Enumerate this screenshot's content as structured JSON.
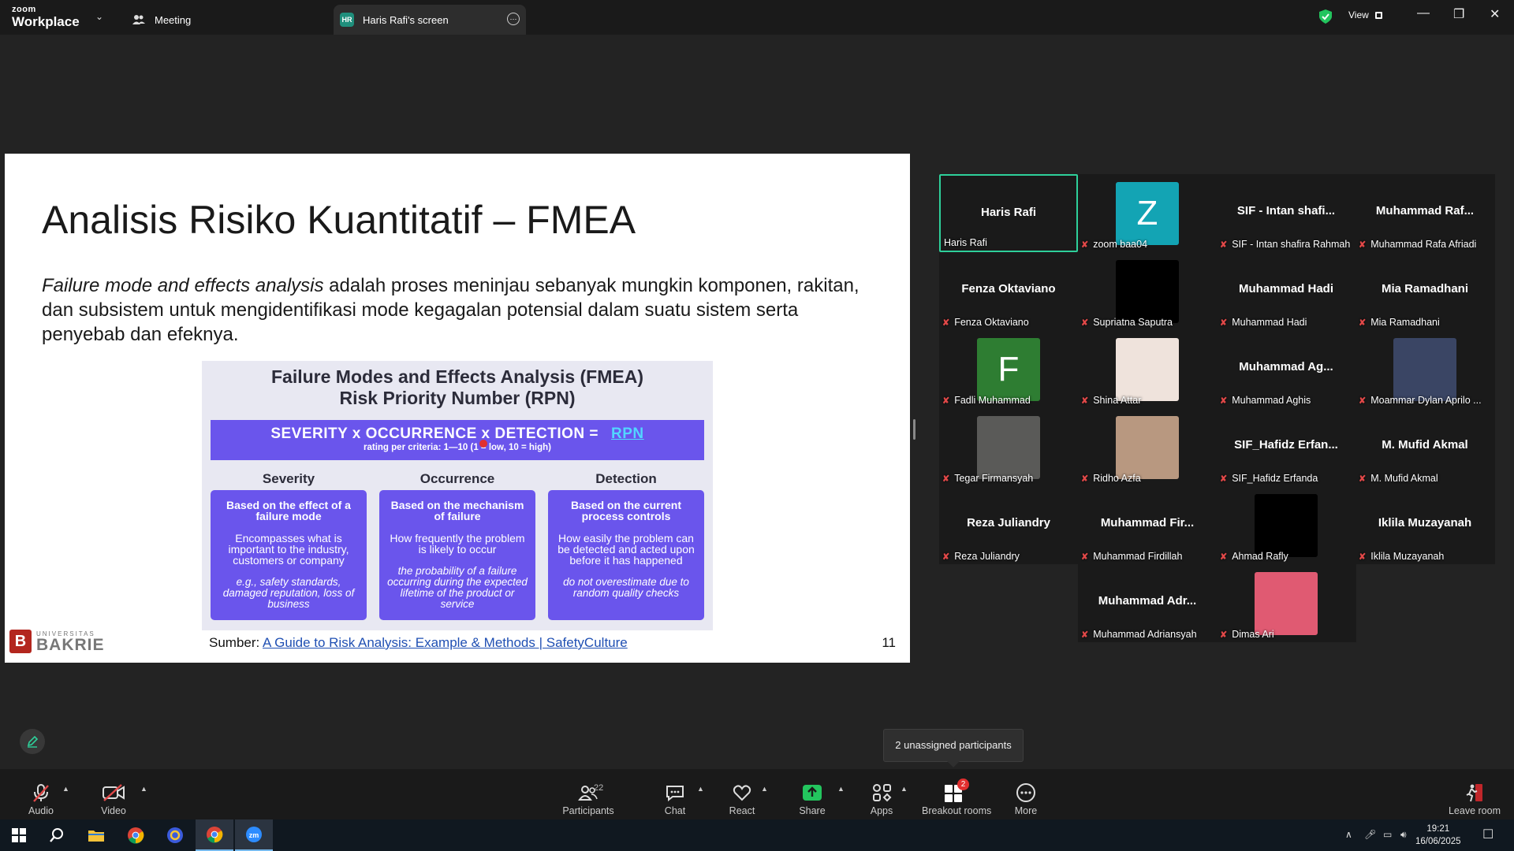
{
  "app": {
    "logo_small": "zoom",
    "logo_big": "Workplace",
    "tab_meeting": "Meeting",
    "tab_screen_initials": "HR",
    "tab_screen": "Haris Rafi's screen",
    "view_label": "View"
  },
  "slide": {
    "title": "Analisis Risiko Kuantitatif – FMEA",
    "para_italic": "Failure mode and effects analysis",
    "para_rest": " adalah proses meninjau sebanyak mungkin komponen, rakitan, dan subsistem untuk mengidentifikasi mode kegagalan potensial dalam suatu sistem serta penyebab dan efeknya.",
    "info_title_1": "Failure Modes and Effects Analysis (FMEA)",
    "info_title_2": "Risk Priority Number (RPN)",
    "formula": "SEVERITY x OCCURRENCE x DETECTION =",
    "formula_result": "RPN",
    "formula_sub": "rating per criteria: 1—10 (1 = low, 10 = high)",
    "columns": [
      {
        "head": "Severity",
        "card_h": "Based on the effect of a failure mode",
        "card_d": "Encompasses what is important to the industry, customers or company",
        "card_e": "e.g., safety standards, damaged reputation, loss of business"
      },
      {
        "head": "Occurrence",
        "card_h": "Based on the mechanism of failure",
        "card_d": "How frequently the problem is likely to occur",
        "card_e": "the probability of a failure occurring during the expected lifetime of the product or service"
      },
      {
        "head": "Detection",
        "card_h": "Based on the current process controls",
        "card_d": "How easily the problem can be detected and acted upon before it has happened",
        "card_e": "do not overestimate due to random quality checks"
      }
    ],
    "logo_top": "UNIVERSITAS",
    "logo_bottom": "BAKRIE",
    "source_label": "Sumber: ",
    "source_link": "A Guide to Risk Analysis: Example & Methods | SafetyCulture",
    "page_number": "11"
  },
  "participants": [
    {
      "name": "Haris Rafi",
      "label": "Haris Rafi",
      "muted": false,
      "active": true
    },
    {
      "avatar": "Z",
      "avatar_color": "#13a4b4",
      "label": "zoom baa04",
      "muted": true
    },
    {
      "name": "SIF - Intan shafi...",
      "label": "SIF - Intan shafira Rahmah",
      "muted": true
    },
    {
      "name": "Muhammad Raf...",
      "label": "Muhammad Rafa Afriadi",
      "muted": true
    },
    {
      "name": "Fenza Oktaviano",
      "label": "Fenza Oktaviano",
      "muted": true
    },
    {
      "avatar": "",
      "avatar_color": "#000000",
      "label": "Supriatna Saputra",
      "muted": true
    },
    {
      "name": "Muhammad Hadi",
      "label": "Muhammad Hadi",
      "muted": true
    },
    {
      "name": "Mia Ramadhani",
      "label": "Mia Ramadhani",
      "muted": true
    },
    {
      "avatar": "F",
      "avatar_color": "#2e7d32",
      "label": "Fadli Muhammad",
      "muted": true
    },
    {
      "avatar": "",
      "avatar_color": "#efe3dc",
      "label": "Shina Attar",
      "muted": true
    },
    {
      "name": "Muhammad Ag...",
      "label": "Muhammad Aghis",
      "muted": true
    },
    {
      "avatar": "",
      "avatar_color": "#3a4564",
      "label": "Moammar Dylan Aprilo ...",
      "muted": true
    },
    {
      "avatar": "",
      "avatar_color": "#5a5a58",
      "label": "Tegar Firmansyah",
      "muted": true
    },
    {
      "avatar": "",
      "avatar_color": "#b89880",
      "label": "Ridho Azfa",
      "muted": true
    },
    {
      "name": "SIF_Hafidz Erfan...",
      "label": "SIF_Hafidz Erfanda",
      "muted": true
    },
    {
      "name": "M. Mufid Akmal",
      "label": "M. Mufid Akmal",
      "muted": true
    },
    {
      "name": "Reza Juliandry",
      "label": "Reza Juliandry",
      "muted": true
    },
    {
      "name": "Muhammad Fir...",
      "label": "Muhammad Firdillah",
      "muted": true
    },
    {
      "avatar": "",
      "avatar_color": "#000000",
      "label": "Ahmad Rafly",
      "muted": true
    },
    {
      "name": "Iklila Muzayanah",
      "label": "Iklila Muzayanah",
      "muted": true
    },
    {
      "name": "Muhammad Adr...",
      "label": "Muhammad Adriansyah",
      "muted": true
    },
    {
      "avatar": "",
      "avatar_color": "#e05a72",
      "label": "Dimas Ari",
      "muted": true
    }
  ],
  "tooltip": "2 unassigned participants",
  "toolbar": {
    "audio": "Audio",
    "video": "Video",
    "participants": "Participants",
    "participants_count": "22",
    "chat": "Chat",
    "react": "React",
    "share": "Share",
    "apps": "Apps",
    "breakout": "Breakout rooms",
    "breakout_badge": "2",
    "more": "More",
    "leave": "Leave room"
  },
  "taskbar": {
    "time": "19:21",
    "date": "16/06/2025"
  }
}
